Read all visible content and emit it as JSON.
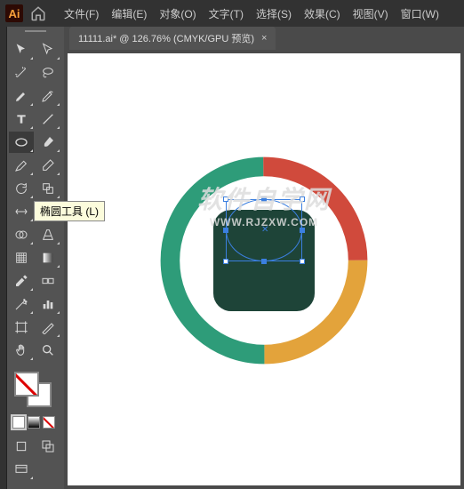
{
  "app": {
    "logo_text": "Ai"
  },
  "menu": {
    "file": "文件(F)",
    "edit": "编辑(E)",
    "object": "对象(O)",
    "type": "文字(T)",
    "select": "选择(S)",
    "effect": "效果(C)",
    "view": "视图(V)",
    "window": "窗口(W)"
  },
  "tab": {
    "label": "11111.ai* @ 126.76% (CMYK/GPU 预览)",
    "close": "×"
  },
  "tooltip": {
    "ellipse_tool": "椭圆工具 (L)"
  },
  "tools": {
    "row1": [
      "selection",
      "direct-selection"
    ],
    "row2": [
      "magic-wand",
      "lasso"
    ],
    "row3": [
      "pen",
      "curvature"
    ],
    "row4": [
      "type",
      "line"
    ],
    "row5": [
      "ellipse",
      "paintbrush"
    ],
    "row6": [
      "shaper",
      "eraser"
    ],
    "row7": [
      "rotate",
      "scale"
    ],
    "row8": [
      "width",
      "free-transform"
    ],
    "row9": [
      "shape-builder",
      "perspective"
    ],
    "row10": [
      "mesh",
      "gradient"
    ],
    "row11": [
      "eyedropper",
      "blend"
    ],
    "row12": [
      "symbol-sprayer",
      "column-graph"
    ],
    "row13": [
      "artboard",
      "slice"
    ],
    "row14": [
      "hand",
      "zoom"
    ]
  },
  "artwork": {
    "ring_colors": {
      "q1": "#d04a3c",
      "q2": "#e3a33b",
      "q3": "#2e9c79",
      "q4": "#2e9c79"
    },
    "rect_color": "#1e4438"
  },
  "watermark": {
    "main": "软件自学网",
    "sub": "WWW.RJZXW.COM"
  }
}
